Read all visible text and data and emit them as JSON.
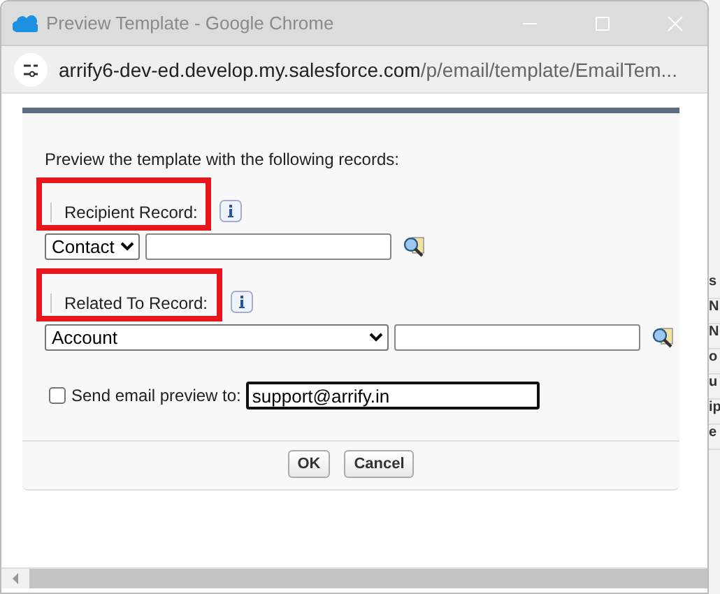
{
  "window": {
    "title": "Preview Template - Google Chrome",
    "url_host": "arrify6-dev-ed.develop.my.salesforce.com",
    "url_path": "/p/email/template/EmailTem..."
  },
  "intro": "Preview the template with the following records:",
  "records": [
    {
      "label": "Recipient Record:",
      "highlighted": true,
      "object": "Contact",
      "wide": false
    },
    {
      "label": "Related To Record:",
      "highlighted": true,
      "object": "Account",
      "wide": true
    }
  ],
  "send_preview": {
    "label": "Send email preview to:",
    "checked": false,
    "value": "support@arrify.in"
  },
  "buttons": [
    "OK",
    "Cancel"
  ],
  "background_fragments": [
    "s",
    "N",
    "N",
    "o",
    "u",
    "ip",
    "e"
  ]
}
